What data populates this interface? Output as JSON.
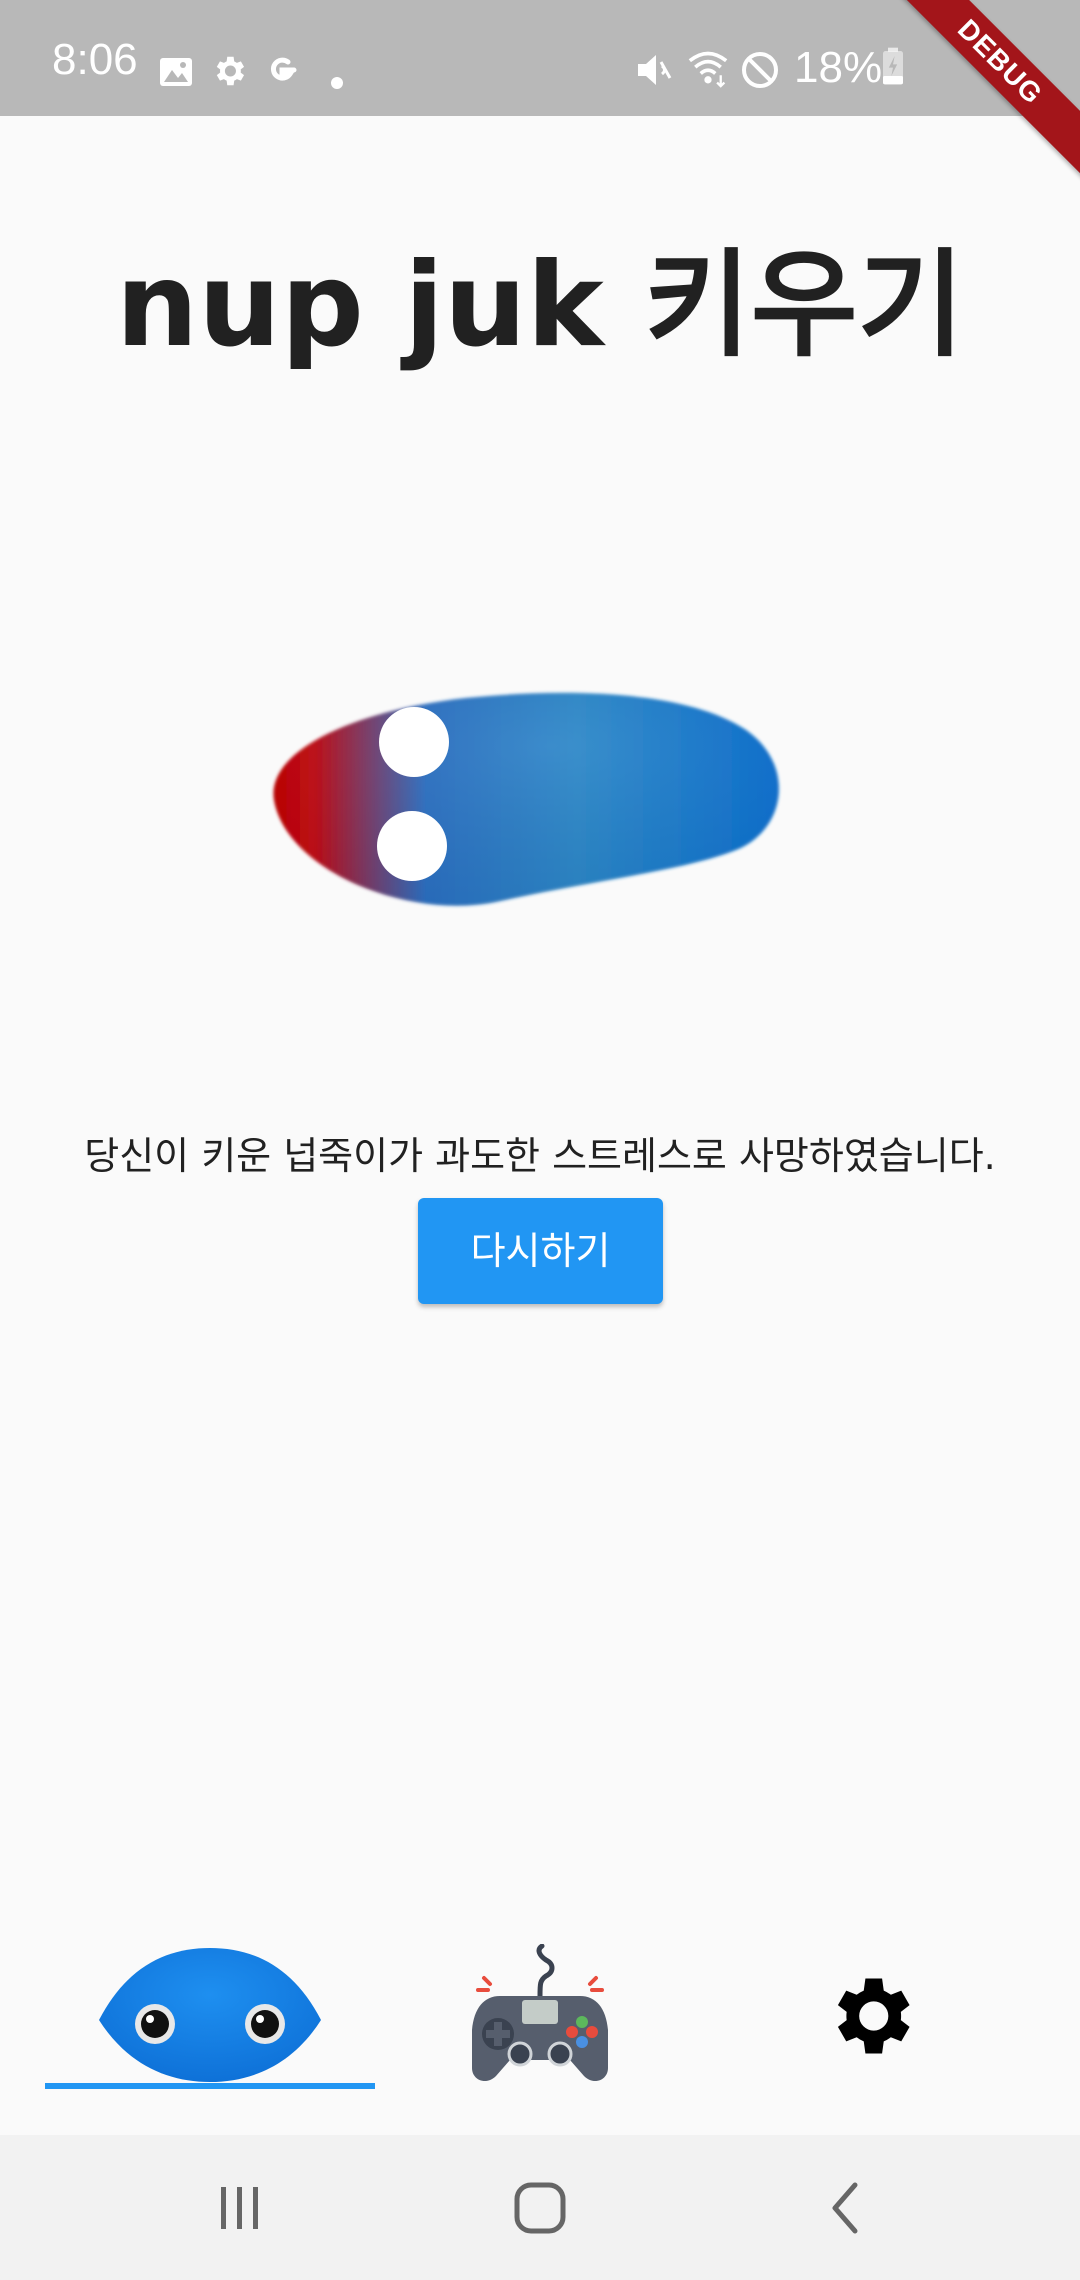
{
  "status_bar": {
    "time": "8:06",
    "battery_percent": "18%",
    "icons": [
      "image-icon",
      "gear-icon",
      "google-icon",
      "dot-icon",
      "mute-icon",
      "wifi-icon",
      "do-not-disturb-icon",
      "battery-icon"
    ]
  },
  "debug_banner": "DEBUG",
  "app": {
    "title": "nup juk 키우기",
    "message": "당신이 키운 넙죽이가 과도한 스트레스로 사망하였습니다.",
    "retry_label": "다시하기"
  },
  "tabs": [
    {
      "name": "nupjuk-tab",
      "icon": "nupjuk-face-icon",
      "selected": true
    },
    {
      "name": "game-tab",
      "icon": "gamepad-icon",
      "selected": false
    },
    {
      "name": "settings-tab",
      "icon": "gear-icon",
      "selected": false
    }
  ],
  "nav_bar": {
    "buttons": [
      "recent-apps-icon",
      "home-icon",
      "back-icon"
    ]
  },
  "colors": {
    "accent": "#2196f3",
    "status_bar": "#b8b8b8",
    "debug_banner": "#a3151a",
    "creature_blue": "#1f7fd0",
    "creature_red": "#c00000"
  }
}
